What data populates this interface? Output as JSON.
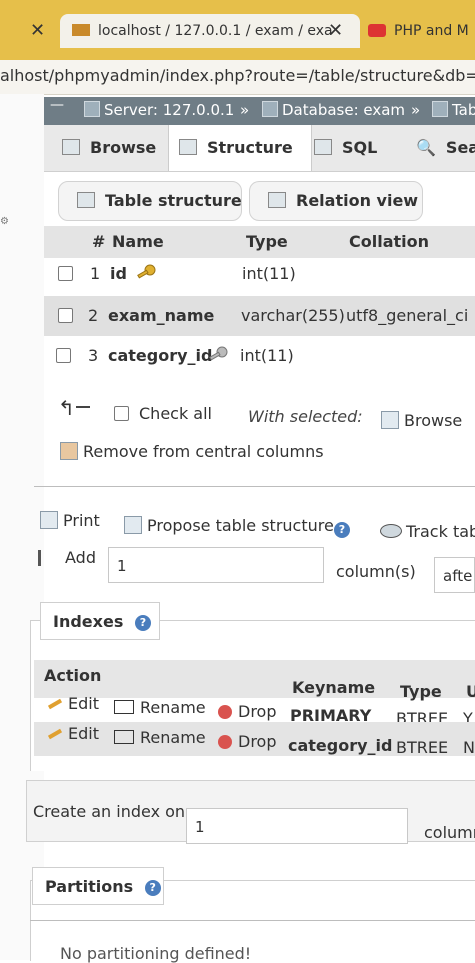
{
  "browser": {
    "tabs": [
      {
        "label": "localhost / 127.0.0.1 / exam / exa"
      },
      {
        "label": "PHP and M"
      }
    ],
    "url": "alhost/phpmyadmin/index.php?route=/table/structure&db=e"
  },
  "breadcrumb": {
    "server": "Server: 127.0.0.1",
    "sep": "»",
    "database": "Database: exam",
    "sep2": "»",
    "table": "Tab"
  },
  "top_tabs": [
    {
      "label": "Browse"
    },
    {
      "label": "Structure"
    },
    {
      "label": "SQL"
    },
    {
      "label": "Sea"
    }
  ],
  "sub_tabs": [
    {
      "label": "Table structure"
    },
    {
      "label": "Relation view"
    }
  ],
  "columns_table": {
    "headers": [
      "#",
      "Name",
      "Type",
      "Collation"
    ],
    "rows": [
      {
        "num": "1",
        "name": "id",
        "type": "int(11)",
        "collation": ""
      },
      {
        "num": "2",
        "name": "exam_name",
        "type": "varchar(255)",
        "collation": "utf8_general_ci"
      },
      {
        "num": "3",
        "name": "category_id",
        "type": "int(11)",
        "collation": ""
      }
    ]
  },
  "bulk": {
    "check_all": "Check all",
    "with_selected": "With selected:",
    "browse": "Browse",
    "remove_central": "Remove from central columns"
  },
  "actions": {
    "print": "Print",
    "propose": "Propose table structure",
    "track": "Track tab",
    "add": "Add",
    "add_value": "1",
    "columns_label": "column(s)",
    "after": "afte"
  },
  "indexes": {
    "legend": "Indexes",
    "headers": {
      "action": "Action",
      "keyname": "Keyname",
      "type": "Type",
      "u": "U"
    },
    "rows": [
      {
        "edit": "Edit",
        "rename": "Rename",
        "drop": "Drop",
        "keyname": "PRIMARY",
        "type": "BTREE",
        "u": "Y"
      },
      {
        "edit": "Edit",
        "rename": "Rename",
        "drop": "Drop",
        "keyname": "category_id",
        "type": "BTREE",
        "u": "N"
      }
    ],
    "create_label": "Create an index on",
    "create_value": "1",
    "create_suffix": "columr"
  },
  "partitions": {
    "legend": "Partitions",
    "note": "No partitioning defined!"
  }
}
